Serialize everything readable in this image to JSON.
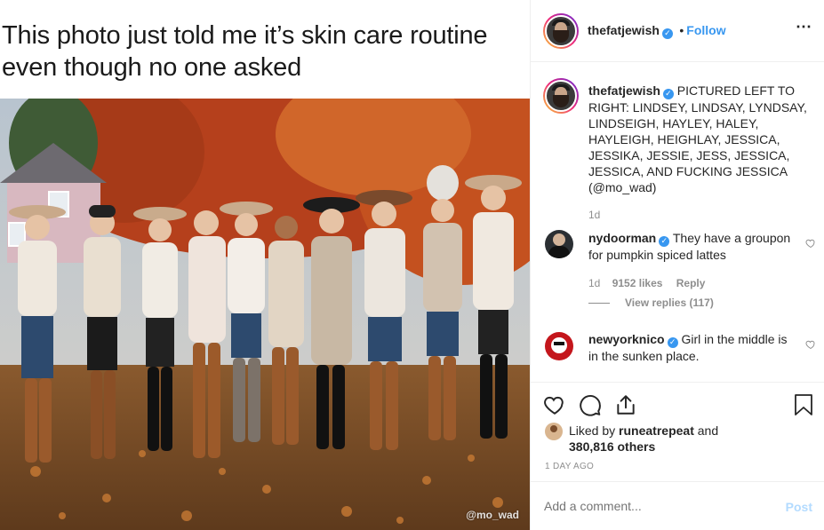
{
  "meme": {
    "caption_line1": "This photo just told me it’s skin care routine",
    "caption_line2": "even though no one asked",
    "watermark": "@mo_wad"
  },
  "post_header": {
    "username": "thefatjewish",
    "separator": "•",
    "follow_label": "Follow",
    "more_icon": "⋯"
  },
  "caption": {
    "username": "thefatjewish",
    "text": "PICTURED LEFT TO RIGHT: LINDSEY, LINDSAY, LYNDSAY, LINDSEIGH, HAYLEY, HALEY, HAYLEIGH, HEIGHLAY, JESSICA, JESSIKA, JESSIE, JESS, JESSICA, JESSICA, AND FUCKING JESSICA (@mo_wad)",
    "time": "1d"
  },
  "comments": [
    {
      "username": "nydoorman",
      "text": "They have a groupon for pumpkin spiced lattes",
      "time": "1d",
      "likes": "9152 likes",
      "reply_label": "Reply",
      "view_replies": "View replies (117)"
    },
    {
      "username": "newyorknico",
      "text": "Girl in the middle is in the sunken place."
    }
  ],
  "likes": {
    "prefix": "Liked by",
    "user": "runeatrepeat",
    "and": "and",
    "others": "380,816 others"
  },
  "post_time": "1 DAY AGO",
  "add_comment": {
    "placeholder": "Add a comment...",
    "post_label": "Post"
  },
  "icons": [
    "heart-icon",
    "comment-icon",
    "share-icon",
    "bookmark-icon",
    "verified-icon",
    "more-options-icon"
  ],
  "colors": {
    "link": "#3897f0",
    "post_disabled": "#b3dbff",
    "meta": "#8e8e8e"
  }
}
